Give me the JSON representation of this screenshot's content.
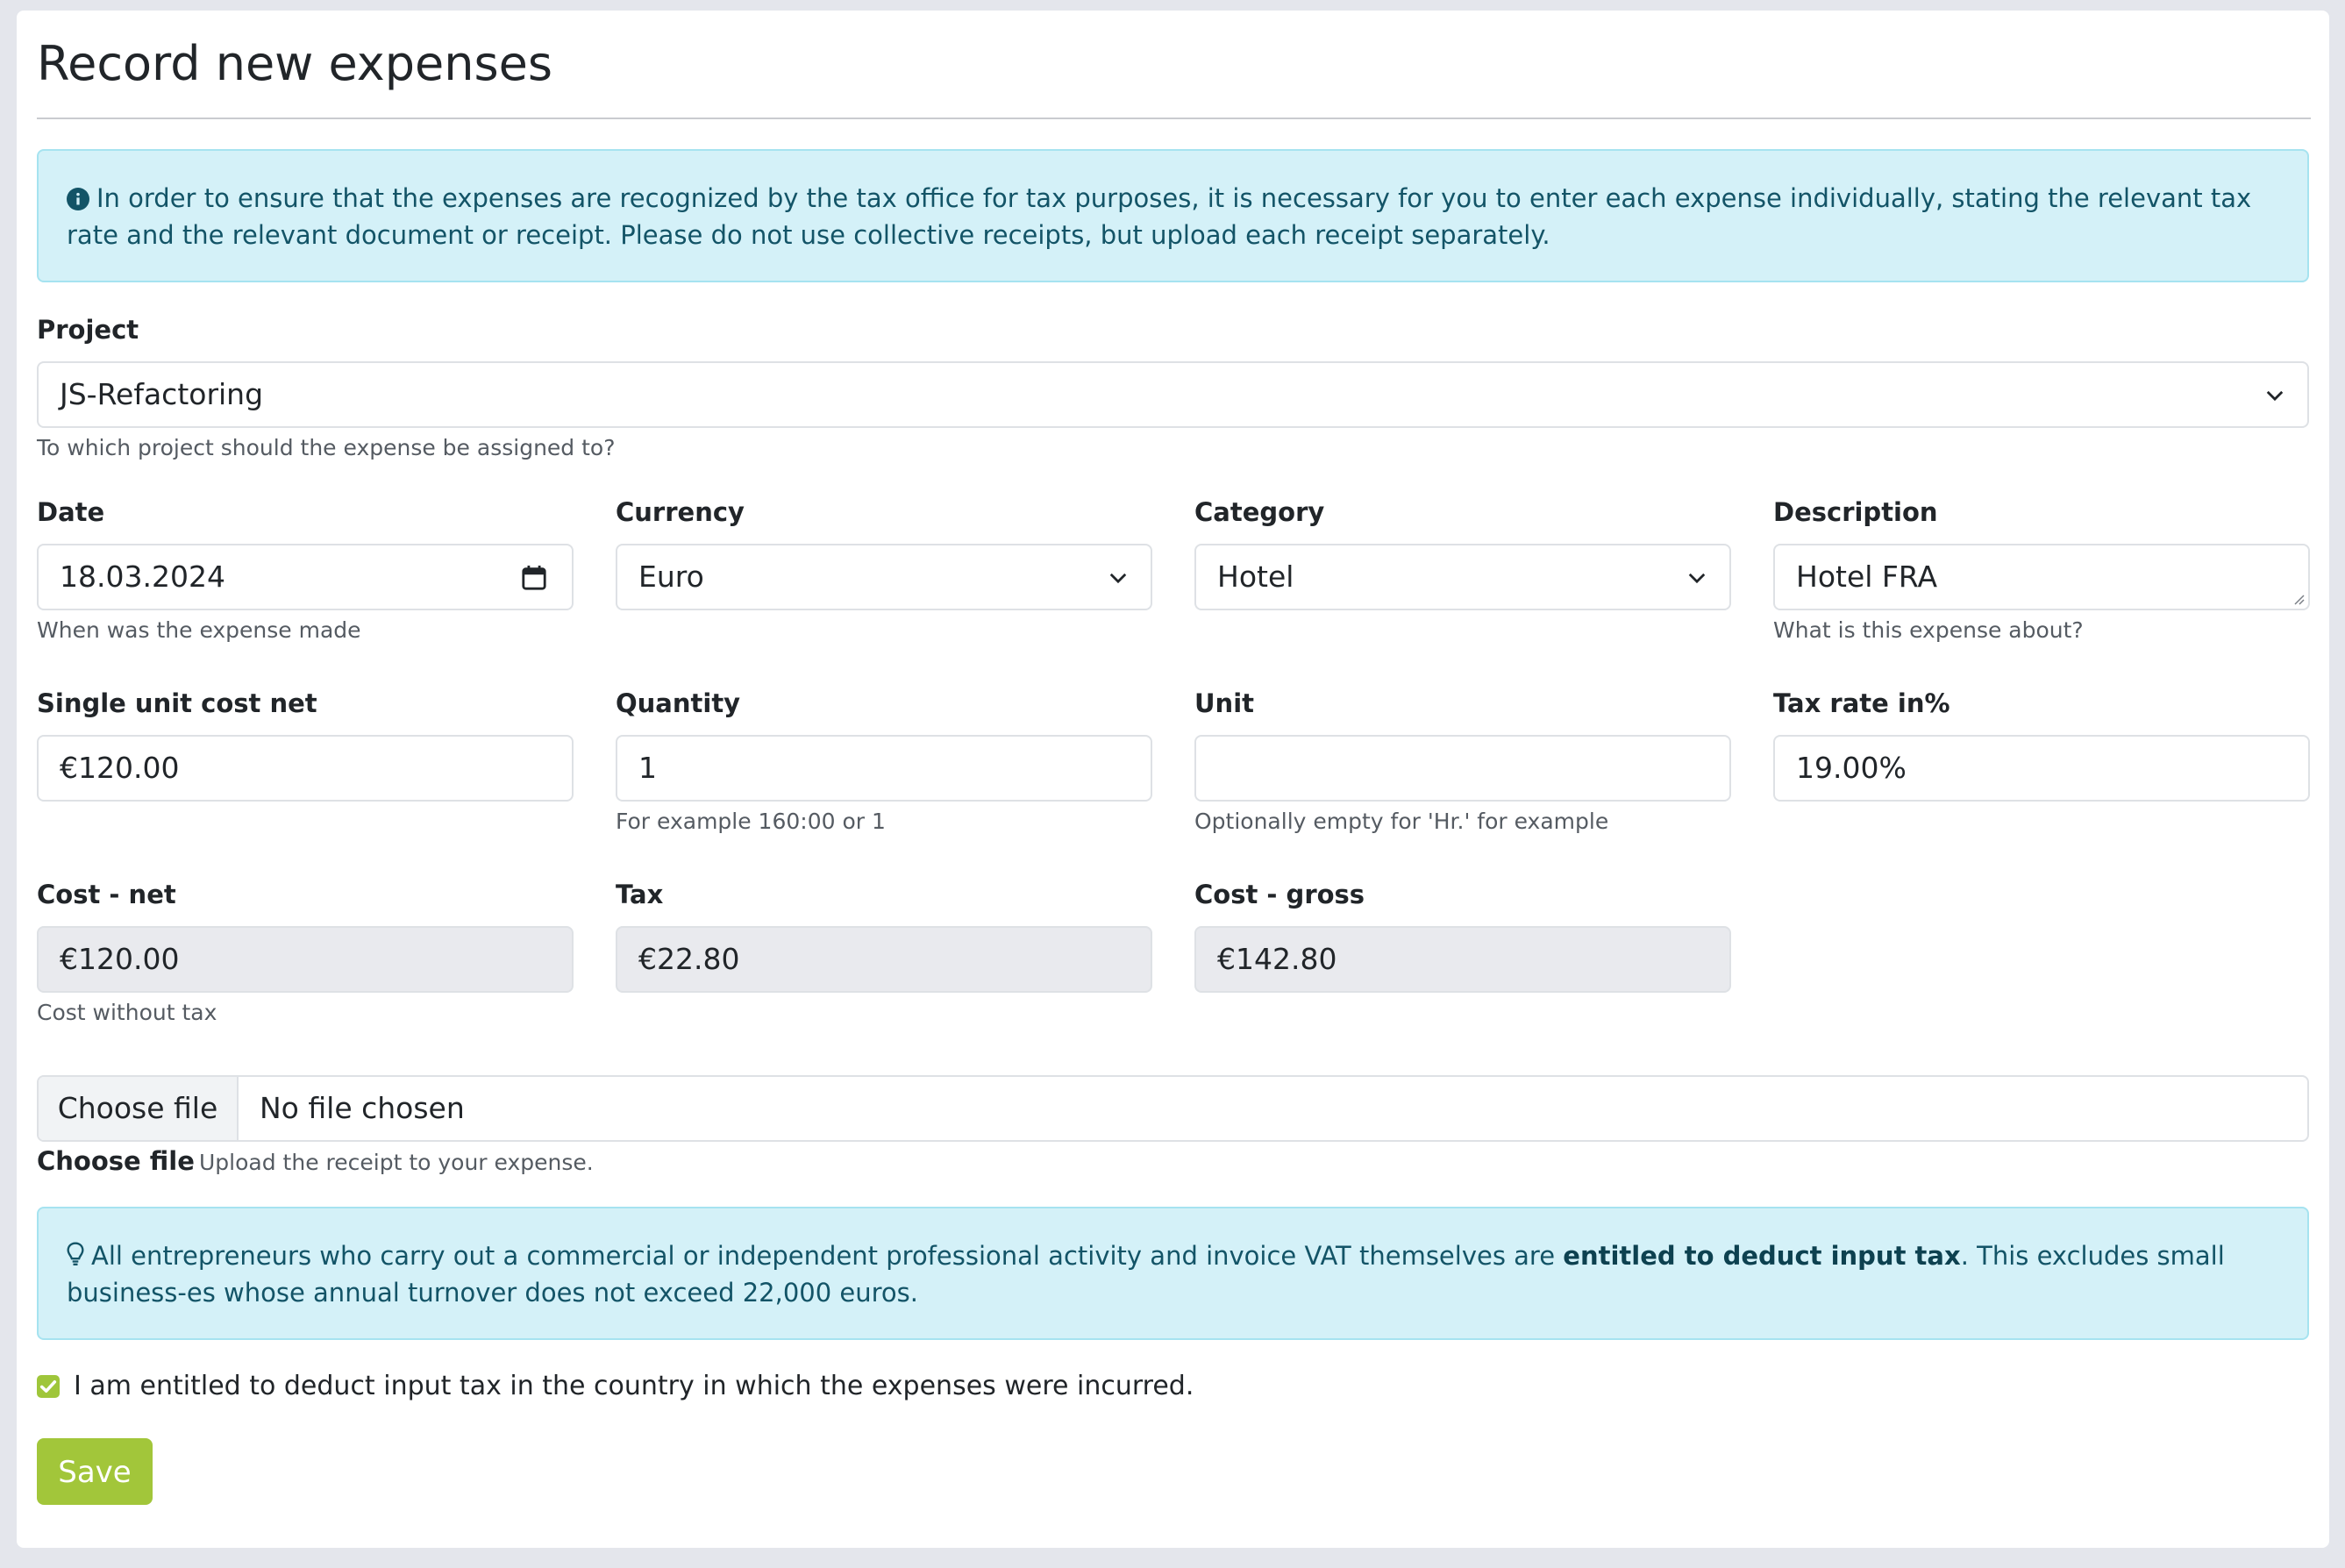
{
  "page": {
    "title": "Record new expenses",
    "info_alert": "In order to ensure that the expenses are recognized by the tax office for tax purposes, it is necessary for you to enter each expense individually, stating the relevant tax rate and the relevant document or receipt. Please do not use collective receipts, but upload each receipt separately."
  },
  "project": {
    "label": "Project",
    "value": "JS-Refactoring",
    "help": "To which project should the expense be assigned to?"
  },
  "date": {
    "label": "Date",
    "value": "18.03.2024",
    "help": "When was the expense made"
  },
  "currency": {
    "label": "Currency",
    "value": "Euro"
  },
  "category": {
    "label": "Category",
    "value": "Hotel"
  },
  "description": {
    "label": "Description",
    "value": "Hotel FRA",
    "help": "What is this expense about?"
  },
  "unit_cost": {
    "label": "Single unit cost net",
    "value": "€120.00"
  },
  "quantity": {
    "label": "Quantity",
    "value": "1",
    "help": "For example 160:00 or 1"
  },
  "unit": {
    "label": "Unit",
    "value": "",
    "help": "Optionally empty for 'Hr.' for example"
  },
  "tax_rate": {
    "label": "Tax rate in%",
    "value": "19.00%"
  },
  "cost_net": {
    "label": "Cost - net",
    "value": "€120.00",
    "help": "Cost without tax"
  },
  "tax": {
    "label": "Tax",
    "value": "€22.80"
  },
  "cost_gross": {
    "label": "Cost - gross",
    "value": "€142.80"
  },
  "file": {
    "button": "Choose file",
    "status": "No file chosen",
    "label": "Choose file",
    "help": "Upload the receipt to your expense."
  },
  "tip_alert": {
    "before": "All entrepreneurs who carry out a commercial or independent professional activity and invoice VAT themselves are ",
    "bold": "entitled to deduct input tax",
    "after": ". This excludes small business-es whose annual turnover does not exceed 22,000 euros."
  },
  "entitlement": {
    "checked": true,
    "label": "I am entitled to deduct input tax in the country in which the expenses were incurred."
  },
  "save_label": "Save",
  "colors": {
    "accent": "#a2c63a",
    "info_bg": "#d4f1f8",
    "info_text": "#135467"
  }
}
